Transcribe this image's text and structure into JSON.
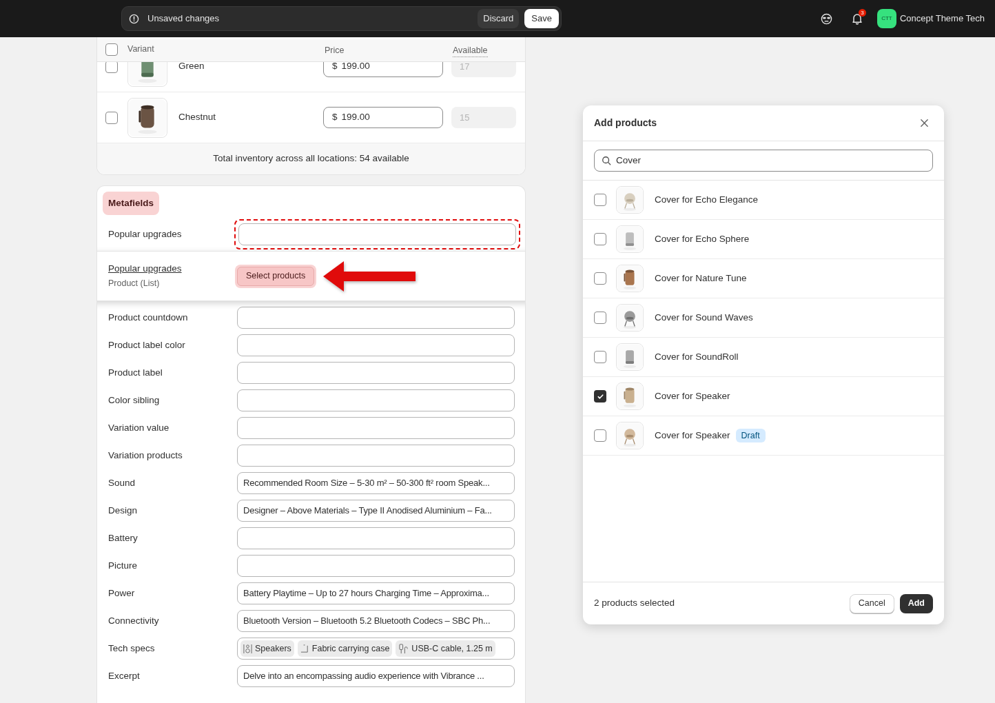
{
  "top_bar": {
    "status": "Unsaved changes",
    "discard": "Discard",
    "save": "Save",
    "notifications": "3",
    "avatar": "CTT",
    "store": "Concept Theme Tech"
  },
  "variants": {
    "all_checked": false,
    "columns": [
      "Variant",
      "Price",
      "Available"
    ],
    "rows": [
      {
        "name": "Green",
        "currency": "$",
        "price": "199.00",
        "available": "17",
        "checked": false
      },
      {
        "name": "Chestnut",
        "currency": "$",
        "price": "199.00",
        "available": "15",
        "checked": false
      }
    ],
    "total": "Total inventory across all locations: 54 available"
  },
  "metafields": {
    "title": "Metafields",
    "rows": [
      {
        "label": "Popular upgrades",
        "kind": "empty",
        "highlighted": true
      },
      {
        "kind": "popover",
        "label": "Popular upgrades",
        "type": "Product (List)",
        "button": "Select products"
      },
      {
        "label": "Product countdown",
        "kind": "empty",
        "highlighted": false
      },
      {
        "label": "Product label color",
        "kind": "empty",
        "highlighted": false
      },
      {
        "label": "Product label",
        "kind": "empty",
        "highlighted": false
      },
      {
        "label": "Color sibling",
        "kind": "empty",
        "highlighted": false
      },
      {
        "label": "Variation value",
        "kind": "empty",
        "highlighted": false
      },
      {
        "label": "Variation products",
        "kind": "empty",
        "highlighted": false
      },
      {
        "label": "Sound",
        "kind": "text",
        "value": "Recommended Room Size – 5-30 m² – 50-300 ft² room Speak...",
        "highlighted": false
      },
      {
        "label": "Design",
        "kind": "text",
        "value": "Designer – Above Materials – Type II Anodised Aluminium – Fa...",
        "highlighted": false
      },
      {
        "label": "Battery",
        "kind": "empty",
        "highlighted": false
      },
      {
        "label": "Picture",
        "kind": "empty",
        "highlighted": false
      },
      {
        "label": "Power",
        "kind": "text",
        "value": "Battery Playtime – Up to 27 hours Charging Time – Approxima...",
        "highlighted": false
      },
      {
        "label": "Connectivity",
        "kind": "text",
        "value": "Bluetooth Version – Bluetooth 5.2 Bluetooth Codecs – SBC Ph...",
        "highlighted": false
      },
      {
        "label": "Tech specs",
        "kind": "chips",
        "chips": [
          "Speakers",
          "Fabric carrying case",
          "USB-C cable, 1.25 m"
        ],
        "highlighted": false
      },
      {
        "label": "Excerpt",
        "kind": "text",
        "value": "Delve into an encompassing audio experience with Vibrance ...",
        "highlighted": false
      }
    ]
  },
  "dialog": {
    "title": "Add products",
    "search": {
      "value": "Cover"
    },
    "items": [
      {
        "name": "Cover for Echo Elegance",
        "checked": false
      },
      {
        "name": "Cover for Echo Sphere",
        "checked": false
      },
      {
        "name": "Cover for Nature Tune",
        "checked": false
      },
      {
        "name": "Cover for Sound Waves",
        "checked": false
      },
      {
        "name": "Cover for SoundRoll",
        "checked": false
      },
      {
        "name": "Cover for Speaker",
        "checked": true
      },
      {
        "name": "Cover for Speaker",
        "checked": false,
        "badge": "Draft"
      }
    ],
    "footer": "2 products selected",
    "cancel": "Cancel",
    "add": "Add"
  }
}
